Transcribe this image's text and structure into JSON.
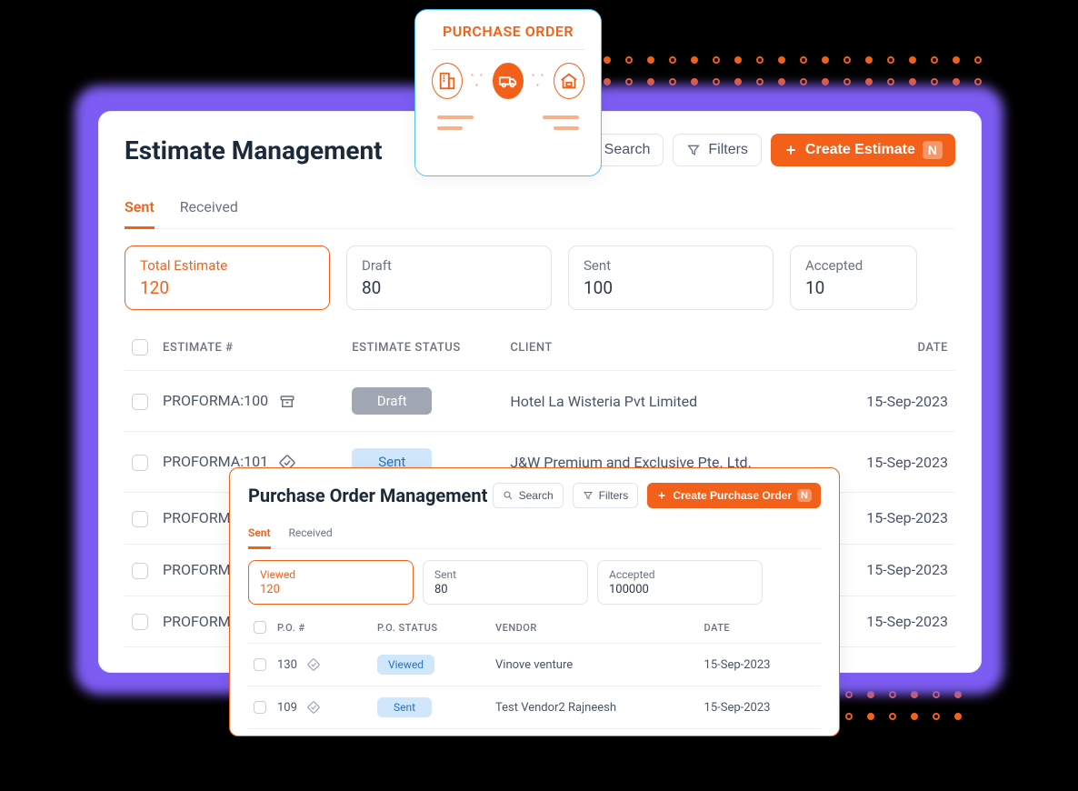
{
  "badge": {
    "title": "PURCHASE ORDER"
  },
  "estimate": {
    "title": "Estimate Management",
    "search_label": "Search",
    "filters_label": "Filters",
    "create_label": "Create Estimate",
    "create_badge": "N",
    "tabs": {
      "sent": "Sent",
      "received": "Received"
    },
    "stats": [
      {
        "label": "Total Estimate",
        "value": "120",
        "active": true
      },
      {
        "label": "Draft",
        "value": "80"
      },
      {
        "label": "Sent",
        "value": "100"
      },
      {
        "label": "Accepted",
        "value": "10"
      }
    ],
    "columns": {
      "num": "ESTIMATE #",
      "status": "ESTIMATE STATUS",
      "client": "CLIENT",
      "date": "DATE"
    },
    "rows": [
      {
        "num": "PROFORMA:100",
        "status": "Draft",
        "client": "Hotel La Wisteria Pvt Limited",
        "date": "15-Sep-2023"
      },
      {
        "num": "PROFORMA:101",
        "status": "Sent",
        "client": "J&W Premium and Exclusive Pte. Ltd.",
        "date": "15-Sep-2023"
      },
      {
        "num": "PROFORMA…",
        "status": "",
        "client": "",
        "date": "15-Sep-2023"
      },
      {
        "num": "PROFORMA…",
        "status": "",
        "client": "",
        "date": "15-Sep-2023"
      },
      {
        "num": "PROFORMA…",
        "status": "",
        "client": "",
        "date": "15-Sep-2023"
      }
    ]
  },
  "po": {
    "title": "Purchase Order Management",
    "search_label": "Search",
    "filters_label": "Filters",
    "create_label": "Create Purchase Order",
    "create_badge": "N",
    "tabs": {
      "sent": "Sent",
      "received": "Received"
    },
    "stats": [
      {
        "label": "Viewed",
        "value": "120",
        "active": true
      },
      {
        "label": "Sent",
        "value": "80"
      },
      {
        "label": "Accepted",
        "value": "100000"
      }
    ],
    "columns": {
      "num": "P.O. #",
      "status": "P.O. STATUS",
      "vendor": "VENDOR",
      "date": "DATE"
    },
    "rows": [
      {
        "num": "130",
        "status": "Viewed",
        "vendor": "Vinove venture",
        "date": "15-Sep-2023"
      },
      {
        "num": "109",
        "status": "Sent",
        "vendor": "Test Vendor2 Rajneesh",
        "date": "15-Sep-2023"
      }
    ]
  }
}
